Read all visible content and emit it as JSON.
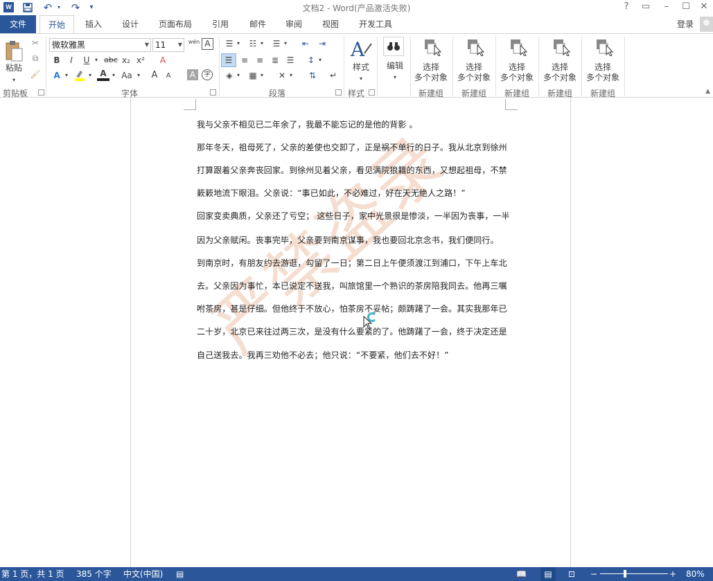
{
  "titlebar": {
    "app_icon": "W",
    "title": "文档2 - Word(产品激活失败)",
    "help": "?",
    "ribbon_display": "▭",
    "minimize": "–",
    "maximize": "☐",
    "close": "✕"
  },
  "quick_access": {
    "save_icon": "save-icon",
    "undo_icon": "undo-icon",
    "redo_icon": "redo-icon",
    "customize_icon": "customize-icon"
  },
  "tabs": {
    "file": "文件",
    "home": "开始",
    "insert": "插入",
    "design": "设计",
    "layout": "页面布局",
    "references": "引用",
    "mailings": "邮件",
    "review": "审阅",
    "view": "视图",
    "developer": "开发工具"
  },
  "account": {
    "login": "登录"
  },
  "ribbon": {
    "clipboard": {
      "paste_label": "粘贴",
      "group_label": "剪贴板"
    },
    "font": {
      "font_name": "微软雅黑",
      "font_size": "11",
      "group_label": "字体",
      "bold": "B",
      "italic": "I",
      "underline": "U",
      "strike": "abc",
      "subscript": "x₂",
      "superscript": "x²",
      "font_color": "A",
      "change_case": "Aa",
      "grow": "A",
      "shrink": "A",
      "char_shading": "A",
      "enclose": "字",
      "clear_format": "A",
      "text_effect": "A",
      "phonetic": "wén",
      "border_char": "A"
    },
    "paragraph": {
      "group_label": "段落"
    },
    "styles": {
      "styles_label": "样式",
      "group_label": "样式"
    },
    "editing": {
      "label": "编辑"
    },
    "new_groups": [
      {
        "line1": "选择",
        "line2": "多个对象",
        "group_label": "新建组"
      },
      {
        "line1": "选择",
        "line2": "多个对象",
        "group_label": "新建组"
      },
      {
        "line1": "选择",
        "line2": "多个对象",
        "group_label": "新建组"
      },
      {
        "line1": "选择",
        "line2": "多个对象",
        "group_label": "新建组"
      },
      {
        "line1": "选择",
        "line2": "多个对象",
        "group_label": "新建组"
      }
    ]
  },
  "document": {
    "paragraphs": [
      "我与父亲不相见已二年余了，我最不能忘记的是他的背影 。",
      "那年冬天，祖母死了，父亲的差使也交卸了，正是祸不单行的日子。我从北京到徐州",
      "打算跟着父亲奔丧回家。到徐州见着父亲，看见满院狼籍的东西，又想起祖母，不禁",
      "簌簌地流下眼泪。父亲说：“事已如此，不必难过，好在天无绝人之路！”",
      "回家变卖典质，父亲还了亏空； 这些日子，家中光景很是惨淡，一半因为丧事，一半",
      "因为父亲赋闲。丧事完毕，父亲要到南京谋事，我也要回北京念书，我们便同行。",
      "到南京时，有朋友约去游逛，勾留了一日；第二日上午便须渡江到浦口，下午上车北",
      "去。父亲因为事忙，本已说定不送我，叫旅馆里一个熟识的茶房陪我同去。他再三嘱",
      "咐茶房，甚是仔细。但他终于不放心，怕茶房不妥帖；颇踌躇了一会。其实我那年已",
      "二十岁，北京已来往过两三次，是没有什么要紧的了。他踌躇了一会，终于决定还是",
      "自己送我去。我再三劝他不必去；他只说：“不要紧，他们去不好！”"
    ],
    "watermark": "严禁盗录"
  },
  "status": {
    "page": "第 1 页，共 1 页",
    "words": "385 个字",
    "language": "中文(中国)",
    "zoom": "80%",
    "zoom_minus": "−",
    "zoom_plus": "+"
  },
  "colors": {
    "accent": "#2b579a",
    "watermark": "#e8b898"
  }
}
